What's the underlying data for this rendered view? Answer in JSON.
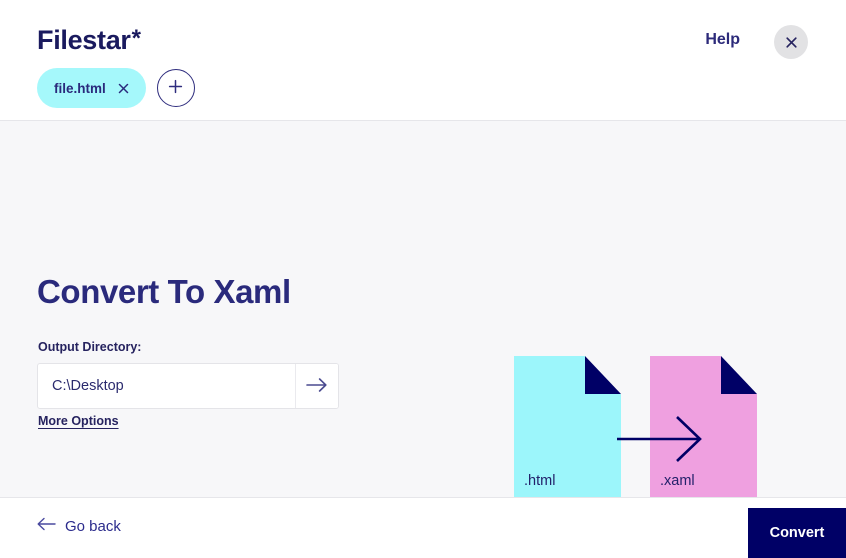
{
  "header": {
    "brand_name": "Filestar",
    "brand_star": "*",
    "help_label": "Help",
    "close_icon": "close-icon",
    "tabs": [
      {
        "label": "file.html",
        "close_icon": "close-icon"
      }
    ],
    "add_tab_icon": "plus-icon"
  },
  "main": {
    "title": "Convert To Xaml",
    "output_directory": {
      "label": "Output Directory:",
      "value": "C:\\Desktop",
      "placeholder": "C:\\Desktop",
      "submit_icon": "arrow-right-icon"
    },
    "more_options_label": "More Options",
    "illustration": {
      "source_doc": {
        "label": ".html",
        "color": "#9cf6fb"
      },
      "target_doc": {
        "label": ".xaml",
        "color": "#efa0e0"
      },
      "fold_color": "#000066",
      "arrow_icon": "arrow-right-icon",
      "arrow_color": "#000066"
    }
  },
  "footer": {
    "back_icon": "arrow-left-icon",
    "back_label": "Go back",
    "convert_label": "Convert",
    "convert_color": "#000066"
  }
}
